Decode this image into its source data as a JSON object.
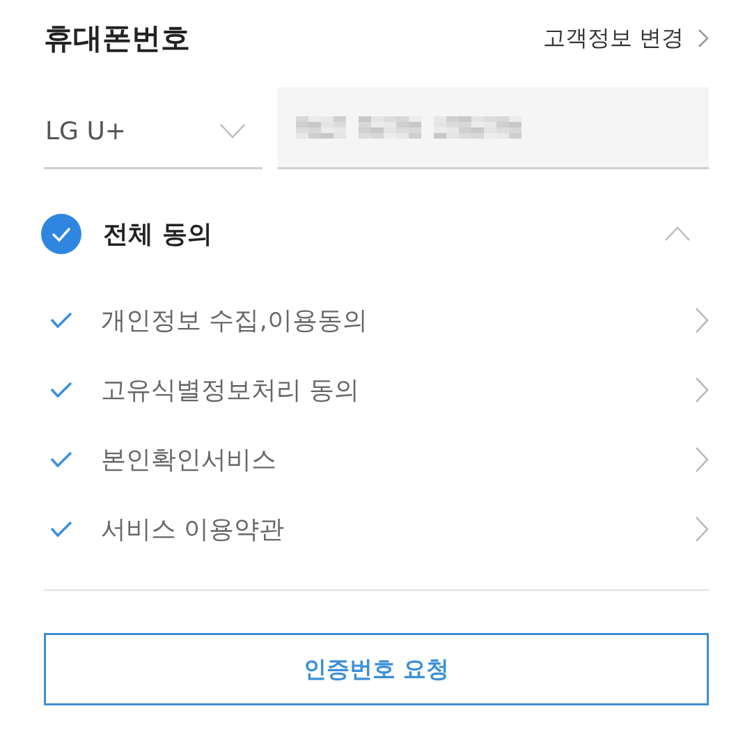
{
  "header": {
    "title": "휴대폰번호",
    "link": "고객정보 변경"
  },
  "carrier_select": {
    "value": "LG U+"
  },
  "phone_field": {
    "redacted": true
  },
  "agree_all": {
    "label": "전체 동의",
    "checked": true,
    "expanded": true
  },
  "agreements": [
    {
      "label": "개인정보 수집,이용동의",
      "checked": true
    },
    {
      "label": "고유식별정보처리 동의",
      "checked": true
    },
    {
      "label": "본인확인서비스",
      "checked": true
    },
    {
      "label": "서비스 이용약관",
      "checked": true
    }
  ],
  "button": {
    "label": "인증번호 요청"
  }
}
